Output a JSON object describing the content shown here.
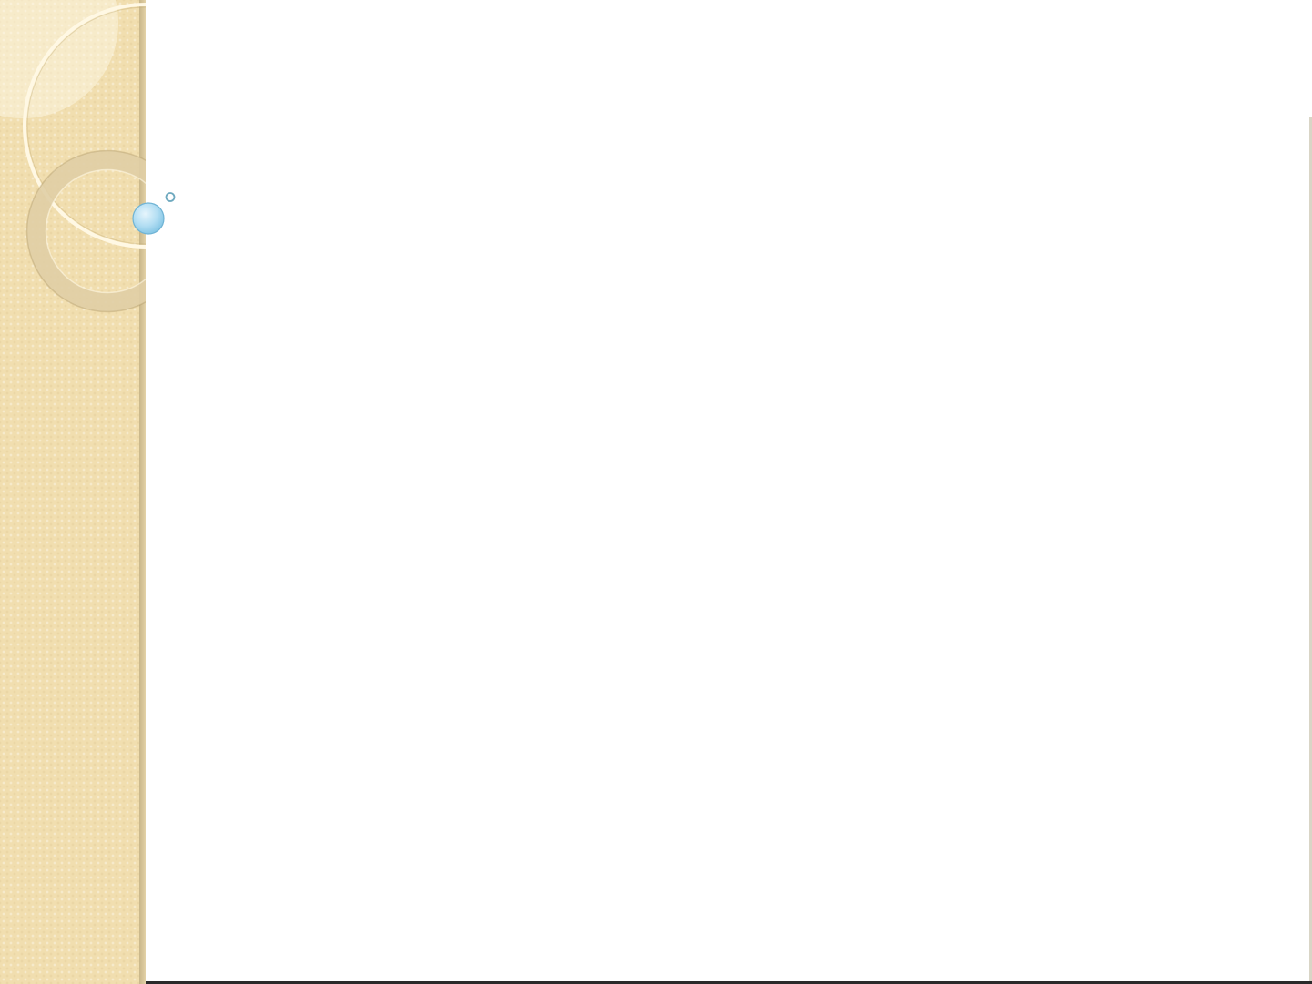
{
  "slide": {
    "background_color": "#ffffff",
    "sidebar_color": "#f1deaf",
    "accent_color": "#a9d6ee"
  },
  "decorations": {
    "large_ring_icon": "ring-outline",
    "medium_ring_icon": "ring-band",
    "orb_icon": "blue-orb",
    "small_bullet_icon": "small-circle-bullet"
  }
}
